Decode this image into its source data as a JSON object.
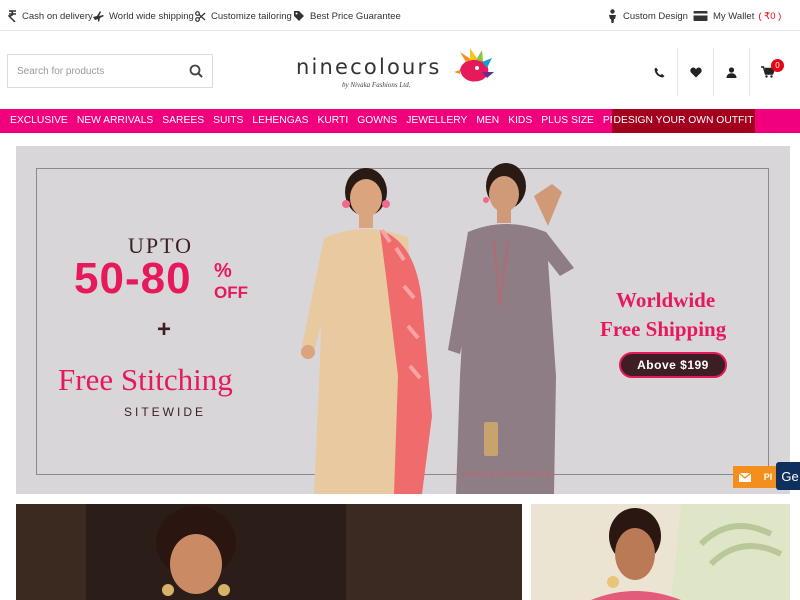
{
  "topbar": {
    "cod": "Cash on delivery",
    "shipping": "World wide shipping",
    "tailoring": "Customize tailoring",
    "price": "Best Price Guarantee",
    "custom_design": "Custom Design",
    "wallet_label": "My Wallet",
    "wallet_amount": "( ₹0 )"
  },
  "search": {
    "placeholder": "Search for products"
  },
  "logo": {
    "brand": "ninecolours",
    "tagline": "by Nivaka Fashions Ltd."
  },
  "header": {
    "cart_count": "0"
  },
  "nav": {
    "items": [
      "EXCLUSIVE",
      "NEW ARRIVALS",
      "SAREES",
      "SUITS",
      "LEHENGAS",
      "KURTI",
      "GOWNS",
      "JEWELLERY",
      "MEN",
      "KIDS",
      "PLUS SIZE",
      "PROMISE"
    ],
    "design_your_own": "DESIGN YOUR OWN OUTFIT"
  },
  "hero": {
    "upto": "UPTO",
    "discount": "50-80",
    "percent": "%",
    "off": "OFF",
    "plus": "+",
    "free_stitching": "Free Stitching",
    "sitewide": "SITEWIDE",
    "worldwide_line1": "Worldwide",
    "worldwide_line2": "Free Shipping",
    "above": "Above $199"
  },
  "widgets": {
    "orange_label": "PI",
    "chat_label": "Ge"
  },
  "colors": {
    "brand_pink": "#f0007c",
    "design_outfit_red": "#a3001e",
    "banner_pink": "#e6195b",
    "banner_dark": "#3c1e24",
    "cart_badge": "#e30613"
  }
}
